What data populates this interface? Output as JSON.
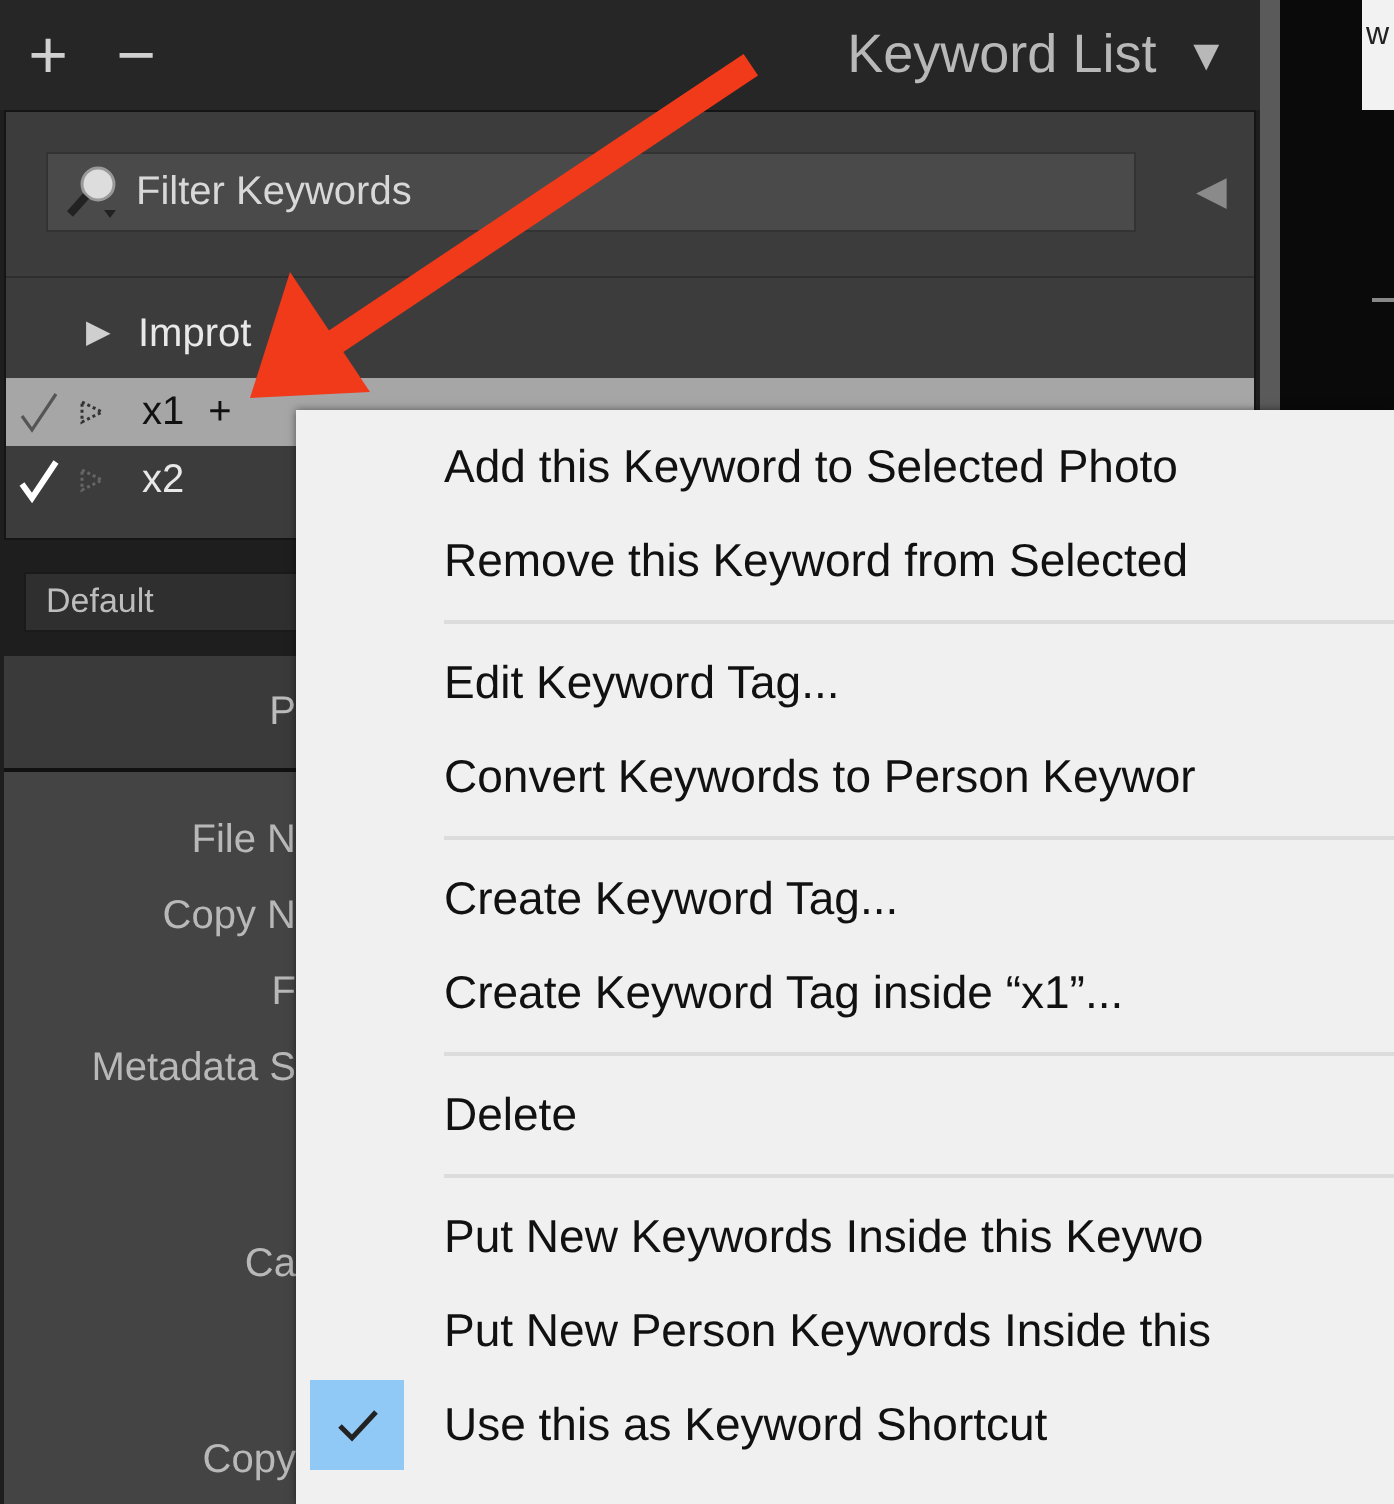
{
  "panel_header": {
    "add": "+",
    "remove": "−",
    "title": "Keyword List",
    "collapse": "▼"
  },
  "filter": {
    "placeholder": "Filter Keywords",
    "toggle": "◀"
  },
  "keywords": [
    {
      "kind": "parent",
      "expander": "▶",
      "name": "Improt",
      "selected": false
    },
    {
      "kind": "keyword",
      "name": "x1",
      "suffix": "+",
      "checked": true,
      "selected": true
    },
    {
      "kind": "keyword",
      "name": "x2",
      "checked": true,
      "selected": false
    }
  ],
  "keyword_set": {
    "value": "Default"
  },
  "metadata_panel": {
    "header": "P",
    "label_groups": [
      [
        "File N",
        "Copy N",
        "F",
        "Metadata S"
      ],
      [
        "Ca"
      ],
      [
        "Copy"
      ]
    ]
  },
  "right_edge_text": "w",
  "context_menu": {
    "groups": [
      [
        {
          "label": "Add this Keyword to Selected Photo",
          "checked": false
        },
        {
          "label": "Remove this Keyword from Selected",
          "checked": false
        }
      ],
      [
        {
          "label": "Edit Keyword Tag...",
          "checked": false
        },
        {
          "label": "Convert Keywords to Person Keywor",
          "checked": false
        }
      ],
      [
        {
          "label": "Create Keyword Tag...",
          "checked": false
        },
        {
          "label": "Create Keyword Tag inside “x1”...",
          "checked": false
        }
      ],
      [
        {
          "label": "Delete",
          "checked": false
        }
      ],
      [
        {
          "label": "Put New Keywords Inside this Keywo",
          "checked": false
        },
        {
          "label": "Put New Person Keywords Inside this",
          "checked": false
        },
        {
          "label": "Use this as Keyword Shortcut",
          "checked": true
        }
      ]
    ]
  }
}
